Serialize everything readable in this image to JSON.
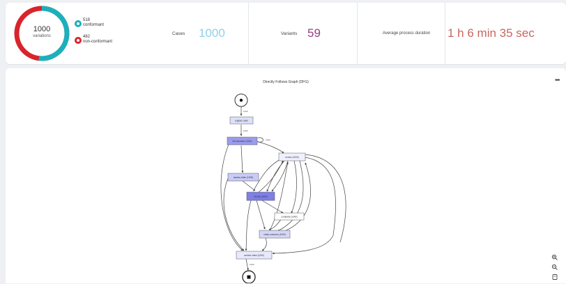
{
  "summary": {
    "total": "1000",
    "total_label": "variations",
    "conformant_count": "518",
    "conformant_label": "conformant",
    "nonconformant_count": "482",
    "nonconformant_label": "non-conformant",
    "conformant_fraction": 0.518,
    "colors": {
      "conformant": "#1ab1bd",
      "nonconformant": "#d9242b"
    },
    "cases_label": "Cases",
    "cases_value": "1000",
    "variants_label": "Variants",
    "variants_value": "59",
    "duration_label": "Average process duration",
    "duration_value": "1 h 6 min 35 sec",
    "value_colors": {
      "cases": "#8fd1ea",
      "variants": "#9a3d86",
      "duration": "#c8665e"
    }
  },
  "graph": {
    "title": "Directly Follows Graph (DFG)",
    "more_icon": "ellipsis-icon",
    "zoom_in_icon": "zoom-in-icon",
    "zoom_out_icon": "zoom-out-icon",
    "reset_icon": "reset-view-icon",
    "nodes": [
      {
        "id": "reg",
        "label": "register claim",
        "shade": "light"
      },
      {
        "id": "fdec",
        "label": "first decision (1000)",
        "shade": "dark"
      },
      {
        "id": "revw",
        "label": "review (1000)",
        "shade": "light"
      },
      {
        "id": "assess",
        "label": "assess claim (1000)",
        "shade": "light"
      },
      {
        "id": "decide",
        "label": "decide (1000)",
        "shade": "dark"
      },
      {
        "id": "compl",
        "label": "complete (1000)",
        "shade": "white"
      },
      {
        "id": "notify",
        "label": "notify customer (1000)",
        "shade": "light"
      },
      {
        "id": "archive",
        "label": "archive claim (1000)",
        "shade": "light"
      }
    ],
    "edges": [
      {
        "label": "1000"
      },
      {
        "label": "1000"
      },
      {
        "label": "1000"
      },
      {
        "label": "1000"
      }
    ]
  }
}
